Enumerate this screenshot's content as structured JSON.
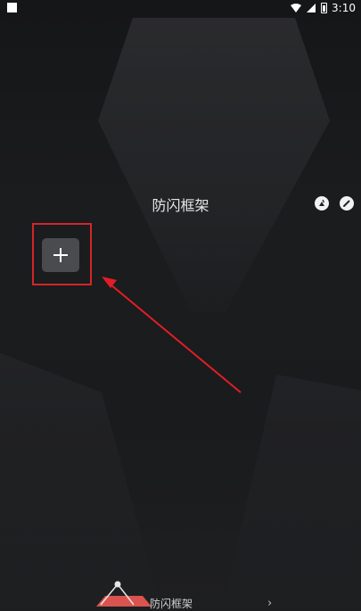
{
  "status_bar": {
    "time": "3:10"
  },
  "header": {
    "title": "防闪框架"
  },
  "main": {
    "add_button_label": "+"
  },
  "bottom": {
    "label": "防闪框架",
    "chevron": "›"
  },
  "colors": {
    "highlight": "#d3262b",
    "background": "#1d1e20",
    "button": "#4a4b4e"
  },
  "icons": [
    "clean-icon",
    "edit-icon",
    "plus-icon",
    "wifi-icon",
    "signal-icon",
    "battery-icon"
  ]
}
